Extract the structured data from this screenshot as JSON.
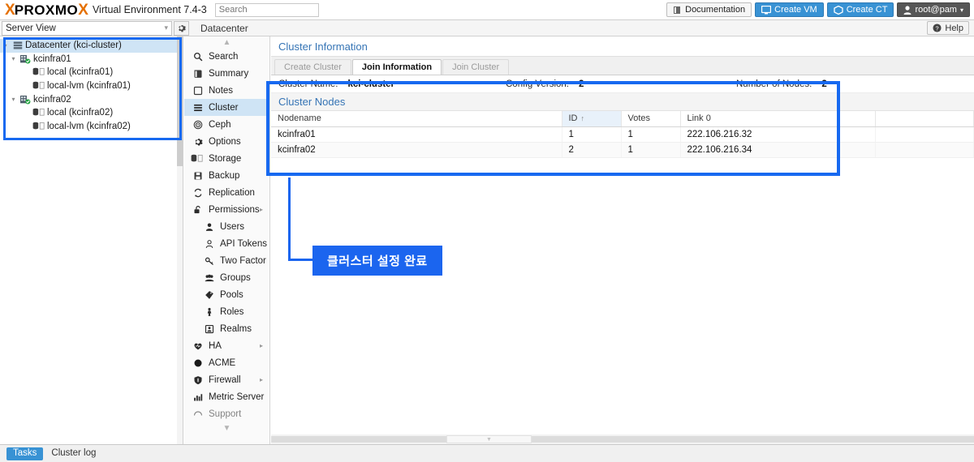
{
  "topbar": {
    "logo_x_left": "X",
    "logo_text": "PROXMO",
    "logo_x_right": "X",
    "product": "Virtual Environment 7.4-3",
    "search_placeholder": "Search",
    "search_value": "",
    "documentation": "Documentation",
    "create_vm": "Create VM",
    "create_ct": "Create CT",
    "user": "root@pam"
  },
  "row2": {
    "view_selector": "Server View",
    "breadcrumb": "Datacenter",
    "help": "Help"
  },
  "tree": {
    "nodes": [
      {
        "label": "Datacenter (kci-cluster)",
        "icon": "datacenter-icon",
        "indent": 0,
        "selected": true,
        "expandable": true
      },
      {
        "label": "kcinfra01",
        "icon": "node-online-icon",
        "indent": 1,
        "selected": false,
        "expandable": true
      },
      {
        "label": "local (kcinfra01)",
        "icon": "storage-icon",
        "indent": 2,
        "selected": false,
        "expandable": false
      },
      {
        "label": "local-lvm (kcinfra01)",
        "icon": "storage-icon",
        "indent": 2,
        "selected": false,
        "expandable": false
      },
      {
        "label": "kcinfra02",
        "icon": "node-online-icon",
        "indent": 1,
        "selected": false,
        "expandable": true
      },
      {
        "label": "local (kcinfra02)",
        "icon": "storage-icon",
        "indent": 2,
        "selected": false,
        "expandable": false
      },
      {
        "label": "local-lvm (kcinfra02)",
        "icon": "storage-icon",
        "indent": 2,
        "selected": false,
        "expandable": false
      }
    ]
  },
  "nav": {
    "items": [
      {
        "label": "Search",
        "icon": "search-icon",
        "active": false,
        "sub": false,
        "arrow": false
      },
      {
        "label": "Summary",
        "icon": "summary-icon",
        "active": false,
        "sub": false,
        "arrow": false
      },
      {
        "label": "Notes",
        "icon": "notes-icon",
        "active": false,
        "sub": false,
        "arrow": false
      },
      {
        "label": "Cluster",
        "icon": "cluster-icon",
        "active": true,
        "sub": false,
        "arrow": false
      },
      {
        "label": "Ceph",
        "icon": "ceph-icon",
        "active": false,
        "sub": false,
        "arrow": false
      },
      {
        "label": "Options",
        "icon": "gear-icon",
        "active": false,
        "sub": false,
        "arrow": false
      },
      {
        "label": "Storage",
        "icon": "storage-icon",
        "active": false,
        "sub": false,
        "arrow": false
      },
      {
        "label": "Backup",
        "icon": "backup-icon",
        "active": false,
        "sub": false,
        "arrow": false
      },
      {
        "label": "Replication",
        "icon": "replication-icon",
        "active": false,
        "sub": false,
        "arrow": false
      },
      {
        "label": "Permissions",
        "icon": "unlock-icon",
        "active": false,
        "sub": false,
        "arrow": true
      },
      {
        "label": "Users",
        "icon": "user-icon",
        "active": false,
        "sub": true,
        "arrow": false
      },
      {
        "label": "API Tokens",
        "icon": "api-token-icon",
        "active": false,
        "sub": true,
        "arrow": false
      },
      {
        "label": "Two Factor",
        "icon": "key-icon",
        "active": false,
        "sub": true,
        "arrow": false
      },
      {
        "label": "Groups",
        "icon": "groups-icon",
        "active": false,
        "sub": true,
        "arrow": false
      },
      {
        "label": "Pools",
        "icon": "pools-icon",
        "active": false,
        "sub": true,
        "arrow": false
      },
      {
        "label": "Roles",
        "icon": "roles-icon",
        "active": false,
        "sub": true,
        "arrow": false
      },
      {
        "label": "Realms",
        "icon": "realms-icon",
        "active": false,
        "sub": true,
        "arrow": false
      },
      {
        "label": "HA",
        "icon": "heart-icon",
        "active": false,
        "sub": false,
        "arrow": true
      },
      {
        "label": "ACME",
        "icon": "acme-icon",
        "active": false,
        "sub": false,
        "arrow": false
      },
      {
        "label": "Firewall",
        "icon": "shield-icon",
        "active": false,
        "sub": false,
        "arrow": true
      },
      {
        "label": "Metric Server",
        "icon": "metric-icon",
        "active": false,
        "sub": false,
        "arrow": false
      },
      {
        "label": "Support",
        "icon": "support-icon",
        "active": false,
        "sub": false,
        "arrow": false
      }
    ]
  },
  "cluster": {
    "title": "Cluster Information",
    "tabs": [
      {
        "label": "Create Cluster",
        "active": false
      },
      {
        "label": "Join Information",
        "active": true
      },
      {
        "label": "Join Cluster",
        "active": false
      }
    ],
    "info": {
      "cluster_name_label": "Cluster Name:",
      "cluster_name_value": "kci-cluster",
      "config_version_label": "Config Version:",
      "config_version_value": "2",
      "number_of_nodes_label": "Number of Nodes:",
      "number_of_nodes_value": "2"
    },
    "nodes_header": "Cluster Nodes",
    "table": {
      "columns": [
        "Nodename",
        "ID",
        "Votes",
        "Link 0"
      ],
      "sort_column": "ID",
      "sort_direction": "↑",
      "rows": [
        {
          "nodename": "kcinfra01",
          "id": "1",
          "votes": "1",
          "link0": "222.106.216.32"
        },
        {
          "nodename": "kcinfra02",
          "id": "2",
          "votes": "1",
          "link0": "222.106.216.34"
        }
      ]
    }
  },
  "annotation": {
    "text": "클러스터 설정 완료",
    "color": "#1b65ef"
  },
  "statusbar": {
    "tabs": [
      {
        "label": "Tasks",
        "active": true
      },
      {
        "label": "Cluster log",
        "active": false
      }
    ]
  },
  "colors": {
    "highlight_blue": "#1769f0",
    "accent_blue": "#3892d4",
    "link_blue": "#3574b5",
    "brand_orange": "#e57000"
  }
}
